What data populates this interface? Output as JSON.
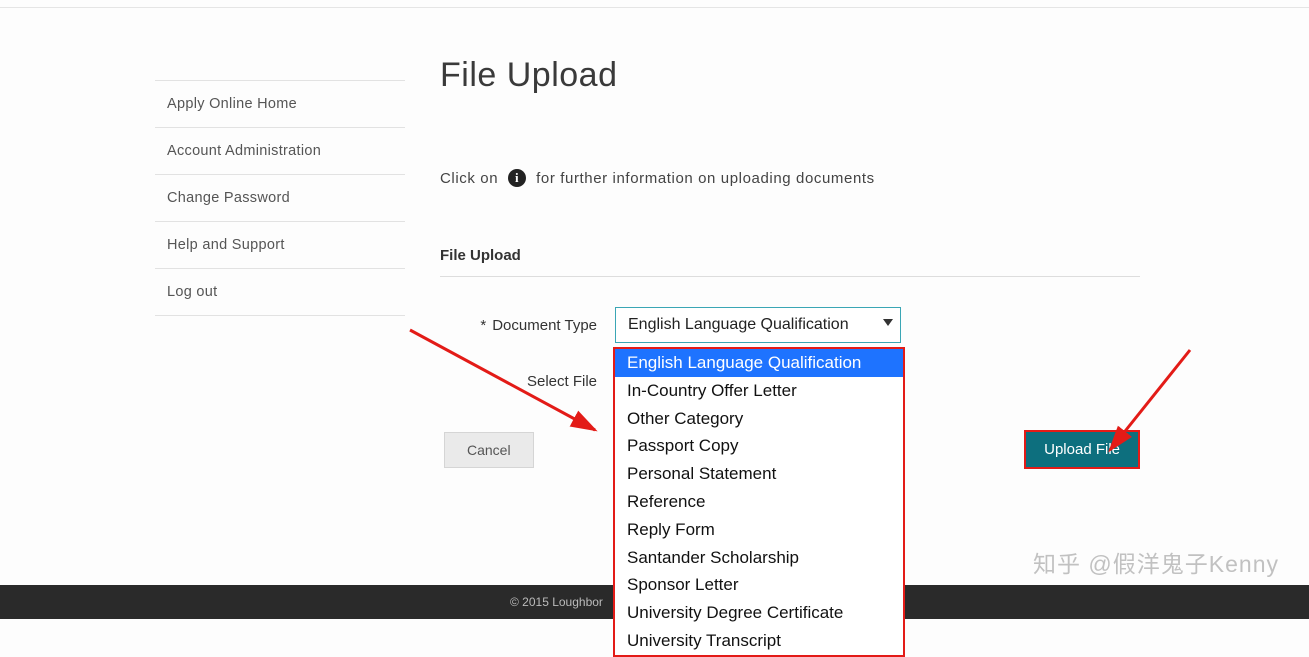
{
  "sidebar": {
    "items": [
      {
        "label": "Apply Online Home"
      },
      {
        "label": "Account Administration"
      },
      {
        "label": "Change Password"
      },
      {
        "label": "Help and Support"
      },
      {
        "label": "Log out"
      }
    ]
  },
  "page": {
    "title": "File Upload",
    "hint_pre": "Click on",
    "hint_post": "for further information on uploading documents",
    "section_label": "File Upload"
  },
  "form": {
    "document_type_label": "Document Type",
    "select_file_label": "Select File",
    "selected_value": "English Language Qualification",
    "options": [
      "English Language Qualification",
      "In-Country Offer Letter",
      "Other Category",
      "Passport Copy",
      "Personal Statement",
      "Reference",
      "Reply Form",
      "Santander Scholarship",
      "Sponsor Letter",
      "University Degree Certificate",
      "University Transcript"
    ]
  },
  "buttons": {
    "cancel": "Cancel",
    "upload": "Upload File"
  },
  "footer": {
    "copyright": "© 2015 Loughbor"
  },
  "watermark": "知乎 @假洋鬼子Kenny"
}
